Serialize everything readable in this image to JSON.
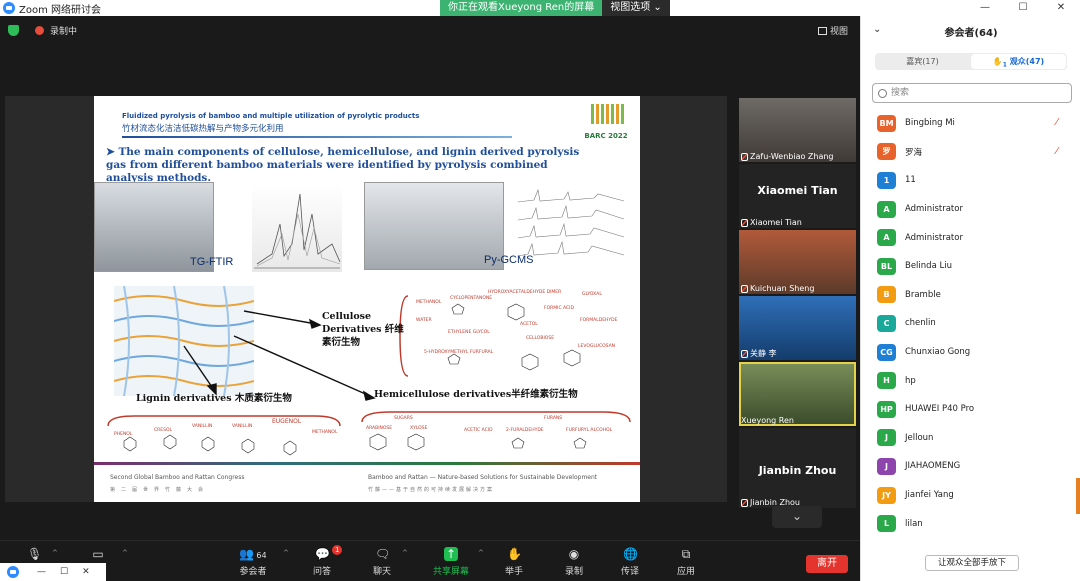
{
  "window": {
    "title": "Zoom 网络研讨会",
    "controls": [
      "—",
      "☐",
      "✕"
    ]
  },
  "share_banner": {
    "viewing": "你正在观看Xueyong Ren的屏幕",
    "options": "视图选项"
  },
  "status": {
    "recording": "录制中",
    "view_label": "视图"
  },
  "slide": {
    "title_en": "Fluidized pyrolysis of bamboo and multiple utilization of pyrolytic products",
    "title_cn": "竹材流态化洁洁低碳热解与产物多元化利用",
    "logo_text": "BARC 2022",
    "bullet": "The main components of cellulose, hemicellulose, and lignin derived pyrolysis gas from different bamboo materials were identified by pyrolysis combined analysis methods.",
    "label_ftir": "TG-FTIR",
    "label_gcms": "Py-GCMS",
    "cellulose": "Cellulose Derivatives 纤维素衍生物",
    "lignin": "Lignin derivatives 木质素衍生物",
    "hemicellulose": "Hemicellulose derivatives半纤维素衍生物",
    "cell_chems": [
      "METHANOL",
      "CYCLOPENTANONE",
      "HYDROXYACETALDEHYDE DIMER",
      "GLYOXAL",
      "WATER",
      "FORMIC ACID",
      "ETHYLENE GLYCOL",
      "ACETOL",
      "FORMALDEHYDE",
      "CELLOBIOSE",
      "5-HYDROXYMETHYL FURFURAL",
      "LEVOGLUCOSAN"
    ],
    "lig_chems": [
      "PHENOL",
      "CRESOL",
      "VANILLIN",
      "VANILLIN",
      "EUGENOL",
      "METHANOL"
    ],
    "hemi_chems": [
      "SUGARS",
      "ARABINOSE",
      "XYLOSE",
      "ACETIC ACID",
      "2-FURALDEHYDE",
      "FURANS",
      "FURFURYL ALCOHOL"
    ],
    "footer_left": "Second Global Bamboo and Rattan Congress",
    "footer_left_cn": "第二届世界竹藤大会",
    "footer_right": "Bamboo and Rattan — Nature-based Solutions for Sustainable Development",
    "footer_right_cn": "竹藤——基于自然的可持续发展解决方案"
  },
  "thumbnails": [
    {
      "name": "Zafu-Wenbiao Zhang",
      "muted": true,
      "video": true
    },
    {
      "name": "Xiaomei Tian",
      "muted": true,
      "video": false,
      "big": "Xiaomei Tian"
    },
    {
      "name": "Kuichuan Sheng",
      "muted": true,
      "video": true
    },
    {
      "name": "关静 李",
      "muted": true,
      "video": true
    },
    {
      "name": "Xueyong Ren",
      "muted": false,
      "video": true,
      "active": true
    },
    {
      "name": "Jianbin Zhou",
      "muted": true,
      "video": false,
      "big": "Jianbin Zhou"
    }
  ],
  "toolbar": {
    "attendees_count": "64",
    "attendees": "参会者",
    "qa": "问答",
    "qa_badge": "1",
    "chat": "聊天",
    "share": "共享屏幕",
    "hand": "举手",
    "record": "录制",
    "translate": "传译",
    "apps": "应用",
    "leave": "离开",
    "partial": "音频"
  },
  "sidebar": {
    "header": "参会者(64)",
    "tab_host": "嘉宾(17)",
    "tab_attendee": "观众(47)",
    "hand_count": "1",
    "search_placeholder": "搜索",
    "lower_hands": "让观众全部手放下",
    "participants": [
      {
        "initials": "BM",
        "name": "Bingbing Mi",
        "color": "#e8622c",
        "muted": true
      },
      {
        "initials": "罗",
        "name": "罗海",
        "color": "#e8622c",
        "muted": true
      },
      {
        "initials": "1",
        "name": "11",
        "color": "#1e7fd4",
        "muted": false
      },
      {
        "initials": "A",
        "name": "Administrator",
        "color": "#2aa84a",
        "muted": false
      },
      {
        "initials": "A",
        "name": "Administrator",
        "color": "#2aa84a",
        "muted": false
      },
      {
        "initials": "BL",
        "name": "Belinda Liu",
        "color": "#2aa84a",
        "muted": false
      },
      {
        "initials": "B",
        "name": "Bramble",
        "color": "#f39c12",
        "muted": false
      },
      {
        "initials": "C",
        "name": "chenlin",
        "color": "#1aa89a",
        "muted": false
      },
      {
        "initials": "CG",
        "name": "Chunxiao Gong",
        "color": "#1e7fd4",
        "muted": false
      },
      {
        "initials": "H",
        "name": "hp",
        "color": "#2aa84a",
        "muted": false
      },
      {
        "initials": "HP",
        "name": "HUAWEI P40 Pro",
        "color": "#2aa84a",
        "muted": false
      },
      {
        "initials": "J",
        "name": "Jelloun",
        "color": "#2aa84a",
        "muted": false
      },
      {
        "initials": "J",
        "name": "JIAHAOMENG",
        "color": "#8e44ad",
        "muted": false
      },
      {
        "initials": "JY",
        "name": "Jianfei Yang",
        "color": "#f39c12",
        "muted": false
      },
      {
        "initials": "L",
        "name": "lilan",
        "color": "#2aa84a",
        "muted": false
      }
    ]
  }
}
